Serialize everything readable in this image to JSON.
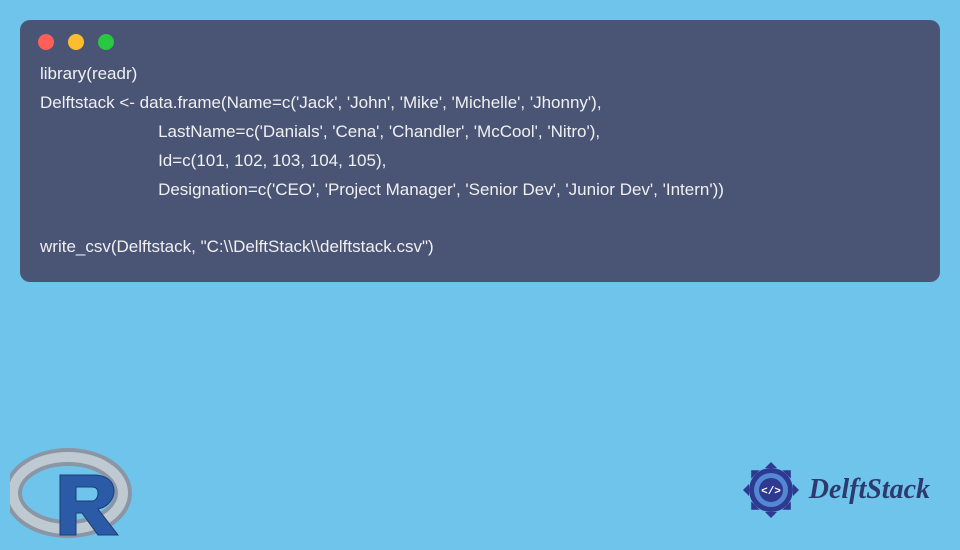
{
  "code": {
    "line1": "library(readr)",
    "line2": "Delftstack <- data.frame(Name=c('Jack', 'John', 'Mike', 'Michelle', 'Jhonny'),",
    "line3": "                         LastName=c('Danials', 'Cena', 'Chandler', 'McCool', 'Nitro'),",
    "line4": "                         Id=c(101, 102, 103, 104, 105),",
    "line5": "                         Designation=c('CEO', 'Project Manager', 'Senior Dev', 'Junior Dev', 'Intern'))",
    "line6": "",
    "line7": "write_csv(Delftstack, \"C:\\\\DelftStack\\\\delftstack.csv\")"
  },
  "brand": {
    "name": "DelftStack"
  }
}
